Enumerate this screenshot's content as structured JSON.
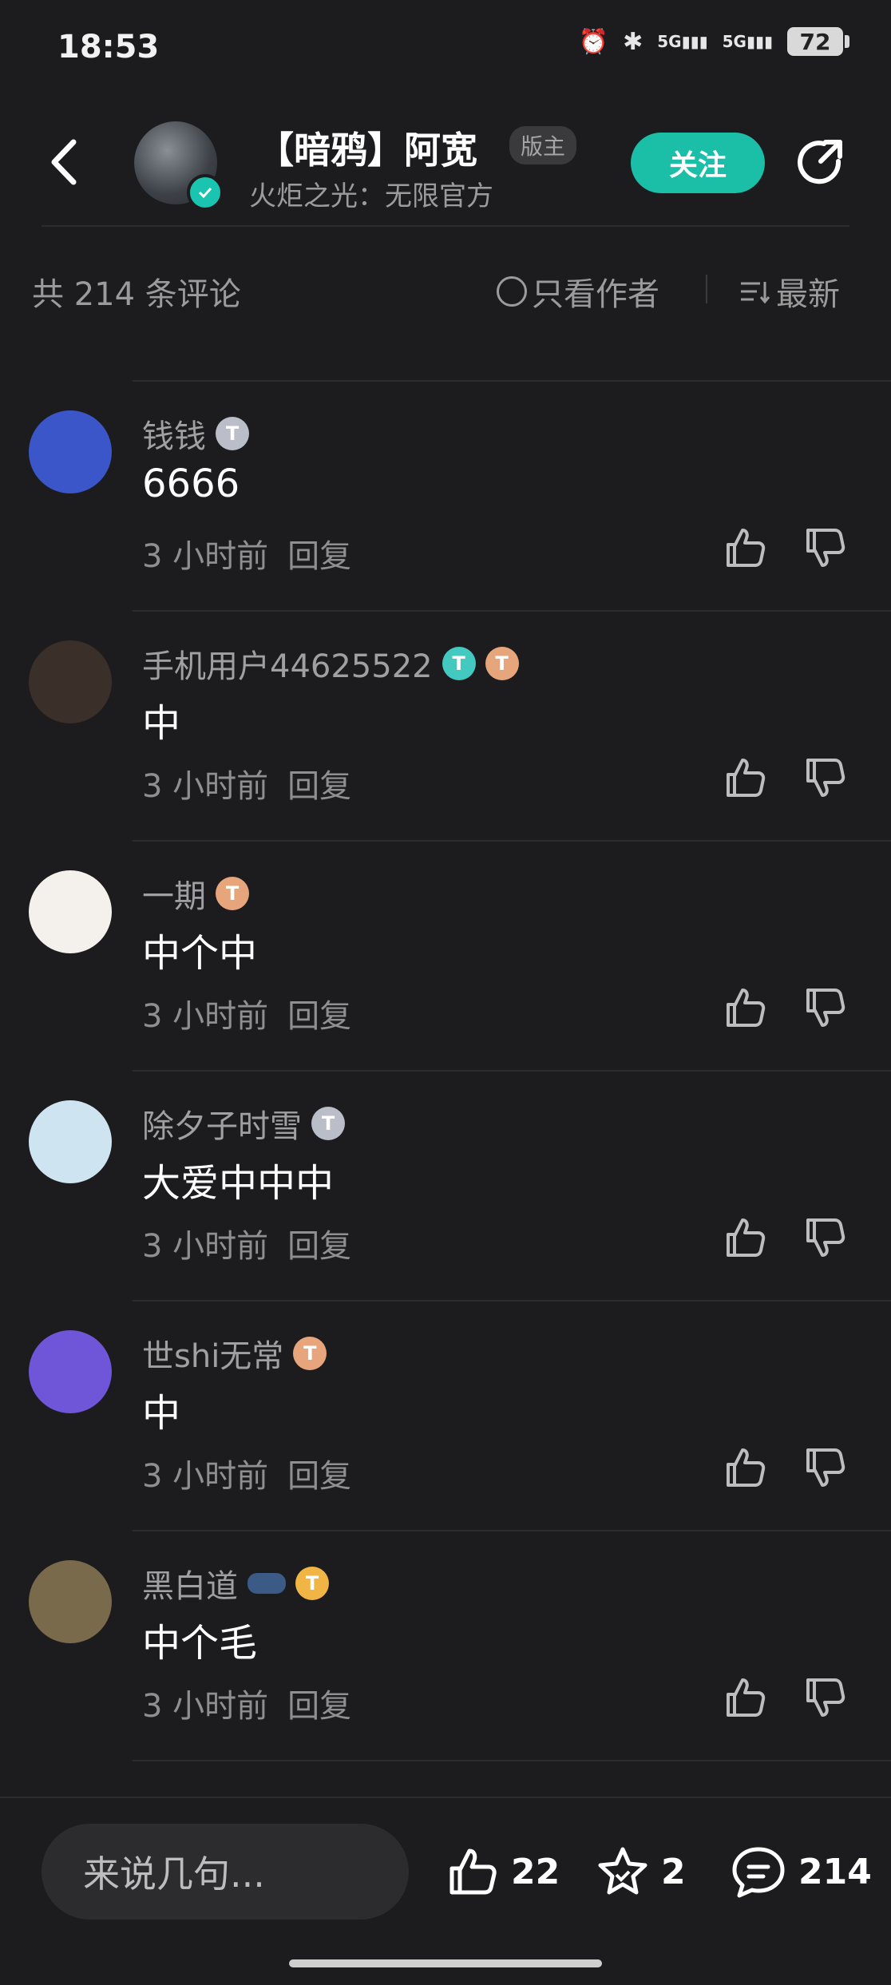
{
  "status_bar": {
    "time": "18:53",
    "battery": "72",
    "signal1": "5G",
    "signal2": "5G"
  },
  "header": {
    "name": "【暗鸦】阿宽",
    "badge": "版主",
    "subtitle": "火炬之光：无限官方",
    "follow_label": "关注"
  },
  "comment_bar": {
    "count_label": "共 214 条评论",
    "author_only_label": "只看作者",
    "sort_label": "最新"
  },
  "comments": [
    {
      "username": "钱钱",
      "text": "6666",
      "time": "3 小时前",
      "reply_label": "回复",
      "avatar_color": "#3a56c8",
      "badges": [
        "silver"
      ]
    },
    {
      "username": "手机用户44625522",
      "text": "中",
      "time": "3 小时前",
      "reply_label": "回复",
      "avatar_color": "#3b2f2a",
      "badges": [
        "teal",
        "bronze"
      ]
    },
    {
      "username": "一期",
      "text": "中个中",
      "time": "3 小时前",
      "reply_label": "回复",
      "avatar_color": "#f4f1ec",
      "badges": [
        "bronze"
      ]
    },
    {
      "username": "除夕子时雪",
      "text": "大爱中中中",
      "time": "3 小时前",
      "reply_label": "回复",
      "avatar_color": "#cfe4f1",
      "badges": [
        "silver"
      ]
    },
    {
      "username": "世shi无常",
      "text": "中",
      "time": "3 小时前",
      "reply_label": "回复",
      "avatar_color": "#6f56d8",
      "badges": [
        "bronze"
      ]
    },
    {
      "username": "黑白道",
      "text": "中个毛",
      "time": "3 小时前",
      "reply_label": "回复",
      "avatar_color": "#7a6a4c",
      "badges": [
        "tag",
        "gold"
      ]
    }
  ],
  "bottom_bar": {
    "input_placeholder": "来说几句...",
    "likes": "22",
    "favorites": "2",
    "comments": "214"
  },
  "colors": {
    "accent": "#1bbfa8",
    "background": "#1c1c1e"
  },
  "icons": [
    "back-icon",
    "verify-icon",
    "share-icon",
    "sort-icon",
    "like-icon",
    "dislike-icon",
    "star-icon",
    "comment-icon"
  ]
}
